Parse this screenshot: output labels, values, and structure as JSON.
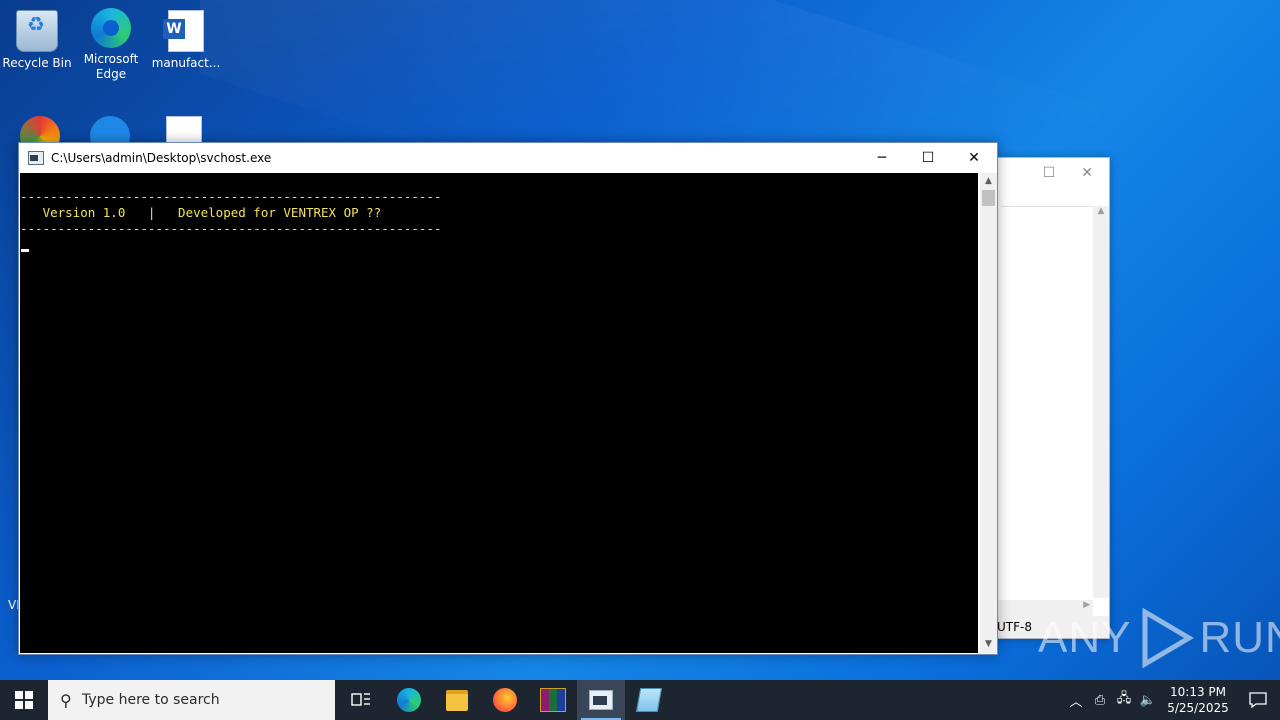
{
  "desktop": {
    "icons": [
      {
        "label": "Recycle Bin"
      },
      {
        "label": "Microsoft Edge"
      },
      {
        "label": "manufact..."
      }
    ],
    "partial_labels": [
      "VL"
    ]
  },
  "console": {
    "title": "C:\\Users\\admin\\Desktop\\svchost.exe",
    "lines": [
      "--------------------------------------------------------",
      "   Version 1.0   |   Developed for VENTREX OP ??",
      "--------------------------------------------------------"
    ],
    "text_color": "#f3e25b"
  },
  "notepad": {
    "encoding": "UTF-8"
  },
  "watermark": {
    "text_left": "ANY",
    "text_right": "RUN"
  },
  "taskbar": {
    "search_placeholder": "Type here to search",
    "apps": [
      "task-view",
      "microsoft-edge",
      "file-explorer",
      "firefox",
      "winrar",
      "console",
      "notepad"
    ],
    "clock_time": "10:13 PM",
    "clock_date": "5/25/2025"
  },
  "colors": {
    "taskbar": "#1c2530",
    "accent": "#7fb7ef"
  }
}
